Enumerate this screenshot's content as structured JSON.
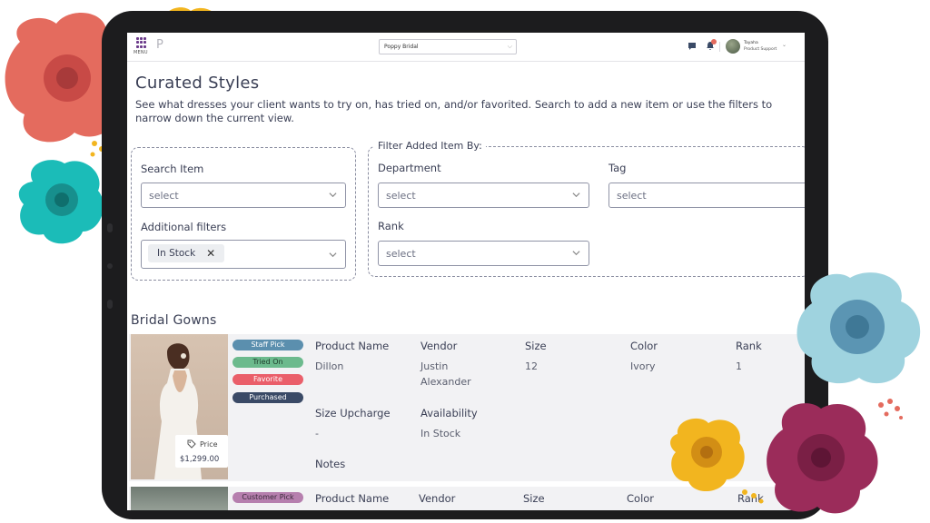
{
  "topbar": {
    "menu_label": "MENU",
    "logo_fragment": "P",
    "store_select_value": "Poppy Bridal",
    "user_name": "Tayaha",
    "user_role": "Product Support"
  },
  "page": {
    "title": "Curated Styles",
    "description": "See what dresses your client wants to try on, has tried on, and/or favorited. Search to add a new item or use the filters to narrow down the current view."
  },
  "search": {
    "search_item_label": "Search Item",
    "search_item_placeholder": "select",
    "additional_filters_label": "Additional filters",
    "additional_filter_tag": "In Stock",
    "remove_symbol": "✕"
  },
  "filters": {
    "legend": "Filter Added Item By:",
    "department_label": "Department",
    "department_placeholder": "select",
    "tag_label": "Tag",
    "tag_placeholder": "select",
    "rank_label": "Rank",
    "rank_placeholder": "select"
  },
  "section": {
    "title": "Bridal Gowns"
  },
  "columns": {
    "product_name": "Product Name",
    "vendor": "Vendor",
    "size": "Size",
    "color": "Color",
    "rank": "Rank",
    "size_upcharge": "Size Upcharge",
    "availability": "Availability",
    "notes": "Notes"
  },
  "items": [
    {
      "badges": [
        "Staff Pick",
        "Tried On",
        "Favorite",
        "Purchased"
      ],
      "price_label": "Price",
      "price": "$1,299.00",
      "product_name": "Dillon",
      "vendor": "Justin Alexander",
      "size": "12",
      "color": "Ivory",
      "rank": "1",
      "size_upcharge": "-",
      "availability": "In Stock"
    },
    {
      "badges": [
        "Customer Pick"
      ]
    }
  ],
  "colors": {
    "staff_pick": "#5b8fae",
    "tried_on": "#6cba8d",
    "favorite": "#ea5f6a",
    "purchased": "#3a4a66",
    "customer_pick": "#b67fae"
  }
}
